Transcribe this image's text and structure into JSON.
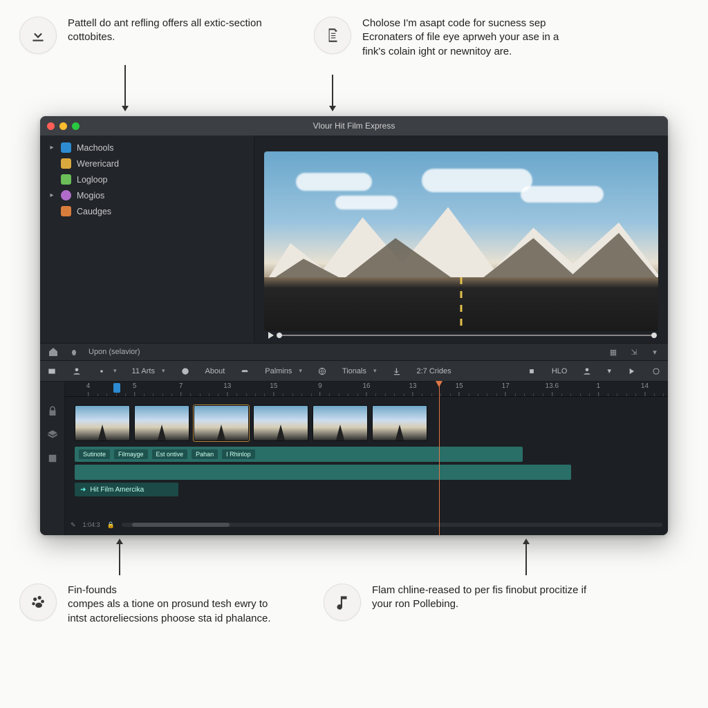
{
  "callouts": {
    "tl": "Pattell do ant refling offers all extic-section cottobites.",
    "tr": "Cholose I'm asapt code for sucness sep Ecronaters of file eye aprweh your ase in a fink's colain ight or newnitoy are.",
    "bl_title": "Fin-founds",
    "bl": "compes als a tione on prosund tesh ewry to intst actoreliecsions phoose sta id phalance.",
    "br": "Flam chline-reased to per fis finobut procitize if your ron Pollebing."
  },
  "window": {
    "title": "Vlour Hit Film Express"
  },
  "sidebar": {
    "items": [
      {
        "label": "Machools",
        "icon": "folder",
        "color": "#2d8bd1",
        "expand": true
      },
      {
        "label": "Werericard",
        "icon": "folder",
        "color": "#d9a93d",
        "expand": false
      },
      {
        "label": "Logloop",
        "icon": "folder",
        "color": "#6bbf59",
        "expand": false
      },
      {
        "label": "Mogios",
        "icon": "target",
        "color": "#b06cc9",
        "expand": true
      },
      {
        "label": "Caudges",
        "icon": "star",
        "color": "#d97d3d",
        "expand": false
      }
    ]
  },
  "midstrip": {
    "label": "Upon (selavior)"
  },
  "toolbar": {
    "arts": "11 Arts",
    "about": "About",
    "palmins": "Palmins",
    "tionals": "Tionals",
    "crides": "2:7 Crides",
    "hlo": "HLO"
  },
  "ruler": [
    "4",
    "5",
    "7",
    "13",
    "15",
    "9",
    "16",
    "13",
    "15",
    "17",
    "13.6",
    "1",
    "14"
  ],
  "greenbar": {
    "seg1": "Sutinote",
    "seg2": "Filmayge",
    "seg3": "Est ontive",
    "seg4": "Pahan",
    "seg5": "I Rhinlop"
  },
  "title_chip": "Hit Film Amercika",
  "bottom_time": "1:04:3"
}
